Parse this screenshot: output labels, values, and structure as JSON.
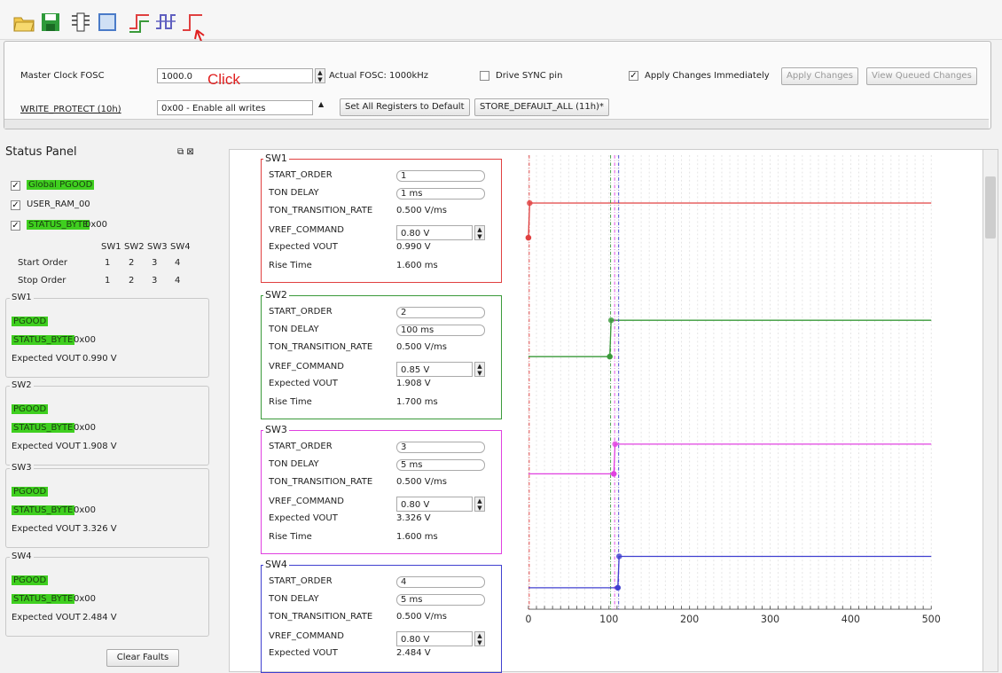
{
  "toolbar": {
    "icons": [
      "open-folder-icon",
      "save-icon",
      "register-icon",
      "register-values-icon",
      "sequencing-icon",
      "waveform-icon",
      "step-icon"
    ],
    "annotation": "Click"
  },
  "config": {
    "master_clock_label": "Master Clock FOSC",
    "master_clock_value": "1000.0",
    "actual_fosc": "Actual FOSC: 1000kHz",
    "drive_sync_label": "Drive SYNC pin",
    "drive_sync_checked": false,
    "apply_immediately_label": "Apply Changes Immediately",
    "apply_immediately_checked": true,
    "apply_changes_btn": "Apply Changes",
    "view_queued_btn": "View Queued Changes",
    "write_protect_label": "WRITE_PROTECT (10h)",
    "write_protect_value": "0x00 - Enable all writes",
    "set_default_btn": "Set All Registers to Default",
    "store_default_btn": "STORE_DEFAULT_ALL (11h)*"
  },
  "status_panel": {
    "title": "Status Panel",
    "global_pgood": "Global PGOOD",
    "user_ram": "USER_RAM_00",
    "status_byte": "STATUS_BYTE",
    "status_byte_value": "0x00",
    "columns": [
      "SW1",
      "SW2",
      "SW3",
      "SW4"
    ],
    "start_order_label": "Start Order",
    "start_order": [
      "1",
      "2",
      "3",
      "4"
    ],
    "stop_order_label": "Stop Order",
    "stop_order": [
      "1",
      "2",
      "3",
      "4"
    ],
    "groups": [
      {
        "name": "SW1",
        "pgood": "PGOOD",
        "status_byte": "STATUS_BYTE",
        "status_value": "0x00",
        "vout_label": "Expected VOUT",
        "vout": "0.990 V"
      },
      {
        "name": "SW2",
        "pgood": "PGOOD",
        "status_byte": "STATUS_BYTE",
        "status_value": "0x00",
        "vout_label": "Expected VOUT",
        "vout": "1.908 V"
      },
      {
        "name": "SW3",
        "pgood": "PGOOD",
        "status_byte": "STATUS_BYTE",
        "status_value": "0x00",
        "vout_label": "Expected VOUT",
        "vout": "3.326 V"
      },
      {
        "name": "SW4",
        "pgood": "PGOOD",
        "status_byte": "STATUS_BYTE",
        "status_value": "0x00",
        "vout_label": "Expected VOUT",
        "vout": "2.484 V"
      }
    ],
    "clear_faults": "Clear Faults"
  },
  "switches": [
    {
      "name": "SW1",
      "color": "#e04040",
      "start_order": "1",
      "ton_delay": "1 ms",
      "ttr": "0.500 V/ms",
      "vref": "0.80 V",
      "vout": "0.990 V",
      "rise": "1.600 ms"
    },
    {
      "name": "SW2",
      "color": "#3a9a3a",
      "start_order": "2",
      "ton_delay": "100 ms",
      "ttr": "0.500 V/ms",
      "vref": "0.85 V",
      "vout": "1.908 V",
      "rise": "1.700 ms"
    },
    {
      "name": "SW3",
      "color": "#e040e0",
      "start_order": "3",
      "ton_delay": "5 ms",
      "ttr": "0.500 V/ms",
      "vref": "0.80 V",
      "vout": "3.326 V",
      "rise": "1.600 ms"
    },
    {
      "name": "SW4",
      "color": "#4040d0",
      "start_order": "4",
      "ton_delay": "5 ms",
      "ttr": "0.500 V/ms",
      "vref": "0.80 V",
      "vout": "2.484 V",
      "rise": ""
    }
  ],
  "labels": {
    "start_order": "START_ORDER",
    "ton_delay": "TON DELAY",
    "ttr": "TON_TRANSITION_RATE",
    "vref": "VREF_COMMAND",
    "vout": "Expected VOUT",
    "rise": "Rise Time"
  },
  "chart_data": {
    "type": "line",
    "xlim": [
      0,
      500
    ],
    "x_ticks": [
      "0",
      "100",
      "200",
      "300",
      "400",
      "500"
    ],
    "series": [
      {
        "color": "#e04040",
        "start": 0,
        "rise_end": 1.6
      },
      {
        "color": "#3a9a3a",
        "start": 101,
        "rise_end": 102.7
      },
      {
        "color": "#e040e0",
        "start": 106,
        "rise_end": 107.6
      },
      {
        "color": "#4040d0",
        "start": 111,
        "rise_end": 112.6
      }
    ]
  }
}
